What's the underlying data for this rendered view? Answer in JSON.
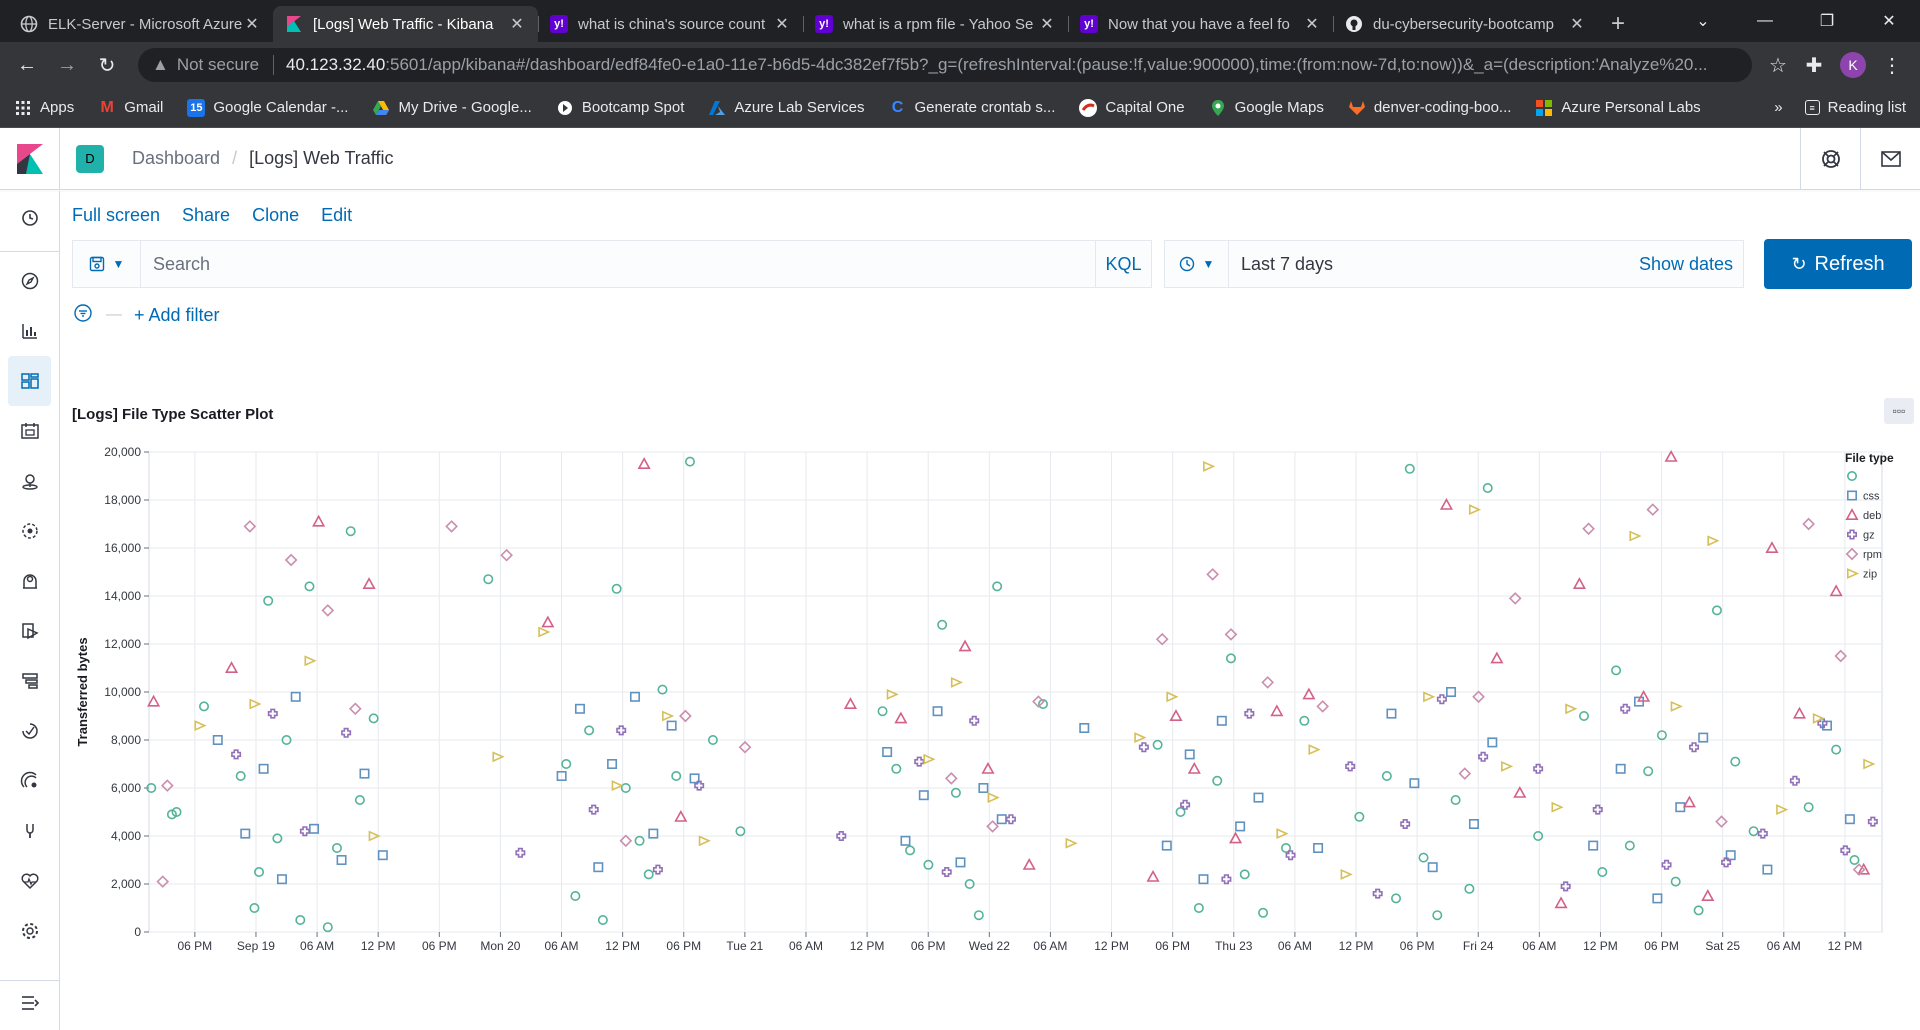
{
  "browser": {
    "tabs": [
      {
        "title": "ELK-Server - Microsoft Azure",
        "icon": "globe-icon",
        "active": false
      },
      {
        "title": "[Logs] Web Traffic - Kibana",
        "icon": "kibana-icon",
        "active": true
      },
      {
        "title": "what is china's source count",
        "icon": "yahoo-icon",
        "active": false
      },
      {
        "title": "what is a rpm file - Yahoo Se",
        "icon": "yahoo-icon",
        "active": false
      },
      {
        "title": "Now that you have a feel fo",
        "icon": "yahoo-icon",
        "active": false
      },
      {
        "title": "du-cybersecurity-bootcamp",
        "icon": "github-icon",
        "active": false
      }
    ],
    "not_secure": "Not secure",
    "url_host": "40.123.32.40",
    "url_path": ":5601/app/kibana#/dashboard/edf84fe0-e1a0-11e7-b6d5-4dc382ef7f5b?_g=(refreshInterval:(pause:!f,value:900000),time:(from:now-7d,to:now))&_a=(description:'Analyze%20...",
    "profile_initial": "K",
    "bookmarks": [
      {
        "label": "Apps",
        "icon": "apps-grid-icon",
        "color": "#4285f4"
      },
      {
        "label": "Gmail",
        "icon": "gmail-icon",
        "color": "#ea4335"
      },
      {
        "label": "Google Calendar -...",
        "icon": "calendar-icon",
        "color": "#1a73e8"
      },
      {
        "label": "My Drive - Google...",
        "icon": "drive-icon",
        "color": "#fbbc04"
      },
      {
        "label": "Bootcamp Spot",
        "icon": "bootcamp-icon",
        "color": "#ffffff"
      },
      {
        "label": "Azure Lab Services",
        "icon": "azure-icon",
        "color": "#0078d4"
      },
      {
        "label": "Generate crontab s...",
        "icon": "crontab-icon",
        "color": "#3a86ff"
      },
      {
        "label": "Capital One",
        "icon": "capital-one-icon",
        "color": "#d22e1e"
      },
      {
        "label": "Google Maps",
        "icon": "maps-pin-icon",
        "color": "#34a853"
      },
      {
        "label": "denver-coding-boo...",
        "icon": "gitlab-icon",
        "color": "#fc6d26"
      },
      {
        "label": "Azure Personal Labs",
        "icon": "windows-icon",
        "color": "#f25022"
      }
    ],
    "reading_list": "Reading list"
  },
  "kibana": {
    "space_initial": "D",
    "breadcrumb": {
      "root": "Dashboard",
      "current": "[Logs] Web Traffic"
    },
    "top_links": [
      "Full screen",
      "Share",
      "Clone",
      "Edit"
    ],
    "search_placeholder": "Search",
    "kql": "KQL",
    "time_range": "Last 7 days",
    "show_dates": "Show dates",
    "refresh_label": "Refresh",
    "add_filter": "+ Add filter",
    "sidebar_icons": [
      "clock-icon",
      "compass-icon",
      "visualize-icon",
      "dashboard-icon",
      "canvas-icon",
      "maps-icon",
      "ml-icon",
      "infra-icon",
      "logs-icon",
      "apm-icon",
      "uptime-icon",
      "siem-icon",
      "dev-tools-icon",
      "monitoring-icon",
      "settings-icon"
    ],
    "panel_title": "[Logs] File Type Scatter Plot",
    "colors": {
      "accent": "#006bb4",
      "teal": "#54b399",
      "blue": "#6092c0",
      "pink": "#d36086",
      "purple": "#9170b8",
      "lilac": "#ca8eae",
      "yellow": "#d6bf57"
    }
  },
  "chart_data": {
    "type": "scatter",
    "title": "",
    "xlabel": "",
    "ylabel": "Transferred bytes",
    "ylim": [
      0,
      20000
    ],
    "y_ticks": [
      "0",
      "2,000",
      "4,000",
      "6,000",
      "8,000",
      "10,000",
      "12,000",
      "14,000",
      "16,000",
      "18,000",
      "20,000"
    ],
    "x_ticks": [
      "06 PM",
      "Sep 19",
      "06 AM",
      "12 PM",
      "06 PM",
      "Mon 20",
      "06 AM",
      "12 PM",
      "06 PM",
      "Tue 21",
      "06 AM",
      "12 PM",
      "06 PM",
      "Wed 22",
      "06 AM",
      "12 PM",
      "06 PM",
      "Thu 23",
      "06 AM",
      "12 PM",
      "06 PM",
      "Fri 24",
      "06 AM",
      "12 PM",
      "06 PM",
      "Sat 25",
      "06 AM",
      "12 PM"
    ],
    "legend_title": "File type",
    "legend_position": "right",
    "grid": true,
    "series": [
      {
        "name": "",
        "symbol": "circle",
        "color": "#54b399",
        "x": [
          0.05,
          0.5,
          0.6,
          1.2,
          2.0,
          2.3,
          2.4,
          2.6,
          2.8,
          3.0,
          3.3,
          3.5,
          3.9,
          4.1,
          4.4,
          4.6,
          4.9,
          7.4,
          9.1,
          9.3,
          9.6,
          9.9,
          10.2,
          10.4,
          10.7,
          10.9,
          11.2,
          11.5,
          11.8,
          12.3,
          12.9,
          16.0,
          16.3,
          16.6,
          17.0,
          17.3,
          17.6,
          17.9,
          18.1,
          18.5,
          19.5,
          22.0,
          22.5,
          22.9,
          23.3,
          23.6,
          23.9,
          24.3,
          24.8,
          25.2,
          26.4,
          27.0,
          27.2,
          27.5,
          27.8,
          28.1,
          28.5,
          28.8,
          29.2,
          30.3,
          31.3,
          31.7,
          32.0,
          32.3,
          32.7,
          33.0,
          33.3,
          33.8,
          34.2,
          34.6,
          35.0,
          36.2,
          36.8,
          37.2
        ],
        "y": [
          6000,
          4900,
          5000,
          9400,
          6500,
          1000,
          2500,
          13800,
          3900,
          8000,
          500,
          14400,
          200,
          3500,
          16700,
          5500,
          8900,
          14700,
          7000,
          1500,
          8400,
          500,
          14300,
          6000,
          3800,
          2400,
          10100,
          6500,
          19600,
          8000,
          4200,
          9200,
          6800,
          3400,
          2800,
          12800,
          5800,
          2000,
          700,
          14400,
          9500,
          7800,
          5000,
          1000,
          6300,
          11400,
          2400,
          800,
          3500,
          8800,
          4800,
          6500,
          1400,
          19300,
          3100,
          700,
          5500,
          1800,
          18500,
          4000,
          9000,
          2500,
          10900,
          3600,
          6700,
          8200,
          2100,
          900,
          13400,
          7100,
          4200,
          5200,
          7600,
          3000
        ]
      },
      {
        "name": "css",
        "symbol": "square",
        "color": "#6092c0",
        "x": [
          1.5,
          2.1,
          2.5,
          2.9,
          3.2,
          3.6,
          4.2,
          4.7,
          5.1,
          9.0,
          9.4,
          9.8,
          10.1,
          10.6,
          11.0,
          11.4,
          11.9,
          16.1,
          16.5,
          16.9,
          17.2,
          17.7,
          18.2,
          18.6,
          20.4,
          22.2,
          22.7,
          23.0,
          23.4,
          23.8,
          24.2,
          25.5,
          27.1,
          27.6,
          28.0,
          28.4,
          28.9,
          29.3,
          31.5,
          32.1,
          32.5,
          32.9,
          33.4,
          33.9,
          34.5,
          35.3,
          36.6,
          37.1
        ],
        "y": [
          8000,
          4100,
          6800,
          2200,
          9800,
          4300,
          3000,
          6600,
          3200,
          6500,
          9300,
          2700,
          7000,
          9800,
          4100,
          8600,
          6400,
          7500,
          3800,
          5700,
          9200,
          2900,
          6000,
          4700,
          8500,
          3600,
          7400,
          2200,
          8800,
          4400,
          5600,
          3500,
          9100,
          6200,
          2700,
          10000,
          4500,
          7900,
          3600,
          6800,
          9600,
          1400,
          5200,
          8100,
          3200,
          2600,
          8600,
          4700
        ]
      },
      {
        "name": "deb",
        "symbol": "triangle",
        "color": "#d36086",
        "x": [
          0.1,
          1.8,
          3.7,
          4.8,
          8.7,
          10.8,
          11.6,
          15.3,
          16.4,
          17.8,
          18.3,
          19.2,
          21.9,
          22.4,
          22.8,
          23.7,
          24.6,
          25.3,
          28.3,
          29.4,
          29.9,
          30.8,
          31.2,
          32.6,
          33.2,
          33.6,
          34.0,
          35.4,
          36.0,
          36.8,
          37.4
        ],
        "y": [
          9600,
          11000,
          17100,
          14500,
          12900,
          19500,
          4800,
          9500,
          8900,
          11900,
          6800,
          2800,
          2300,
          9000,
          6800,
          3900,
          9200,
          9900,
          17800,
          11400,
          5800,
          1200,
          14500,
          9800,
          19800,
          5400,
          1500,
          16000,
          9100,
          14200,
          2600
        ]
      },
      {
        "name": "gz",
        "symbol": "cross",
        "color": "#9170b8",
        "x": [
          1.9,
          2.7,
          3.4,
          4.3,
          8.1,
          9.7,
          10.3,
          11.1,
          12.0,
          15.1,
          16.8,
          17.4,
          18.0,
          18.8,
          21.7,
          22.6,
          23.5,
          24.0,
          24.9,
          26.2,
          26.8,
          27.4,
          28.2,
          29.1,
          30.3,
          30.9,
          31.6,
          32.2,
          33.1,
          33.7,
          34.4,
          35.2,
          35.9,
          36.5,
          37.0,
          37.6
        ],
        "y": [
          7400,
          9100,
          4200,
          8300,
          3300,
          5100,
          8400,
          2600,
          6100,
          4000,
          7100,
          2500,
          8800,
          4700,
          7700,
          5300,
          2200,
          9100,
          3200,
          6900,
          1600,
          4500,
          9700,
          7300,
          6800,
          1900,
          5100,
          9300,
          2800,
          7700,
          2900,
          4100,
          6300,
          8700,
          3400,
          4600
        ]
      },
      {
        "name": "rpm",
        "symbol": "diamond",
        "color": "#ca8eae",
        "x": [
          0.3,
          0.4,
          2.2,
          3.1,
          3.9,
          4.5,
          6.6,
          7.8,
          10.4,
          11.7,
          13.0,
          17.5,
          18.4,
          19.4,
          22.1,
          23.2,
          23.6,
          24.4,
          25.6,
          28.7,
          29.0,
          29.8,
          31.4,
          32.8,
          34.3,
          36.2,
          36.9,
          37.3
        ],
        "y": [
          2100,
          6100,
          16900,
          15500,
          13400,
          9300,
          16900,
          15700,
          3800,
          9000,
          7700,
          6400,
          4400,
          9600,
          12200,
          14900,
          12400,
          10400,
          9400,
          6600,
          9800,
          13900,
          16800,
          17600,
          4600,
          17000,
          11500,
          2600
        ]
      },
      {
        "name": "zip",
        "symbol": "triangle-right",
        "color": "#d6bf57",
        "x": [
          1.1,
          2.3,
          3.5,
          4.9,
          7.6,
          8.6,
          10.2,
          11.3,
          12.1,
          16.2,
          17.0,
          17.6,
          18.4,
          20.1,
          21.6,
          22.3,
          23.1,
          24.7,
          25.4,
          26.1,
          27.9,
          28.9,
          29.6,
          30.7,
          31.0,
          32.4,
          33.3,
          34.1,
          35.6,
          36.4,
          37.5
        ],
        "y": [
          8600,
          9500,
          11300,
          4000,
          7300,
          12500,
          6100,
          9000,
          3800,
          9900,
          7200,
          10400,
          5600,
          3700,
          8100,
          9800,
          19400,
          4100,
          7600,
          2400,
          9800,
          17600,
          6900,
          5200,
          9300,
          16500,
          9400,
          16300,
          5100,
          8900,
          7000
        ]
      }
    ]
  }
}
